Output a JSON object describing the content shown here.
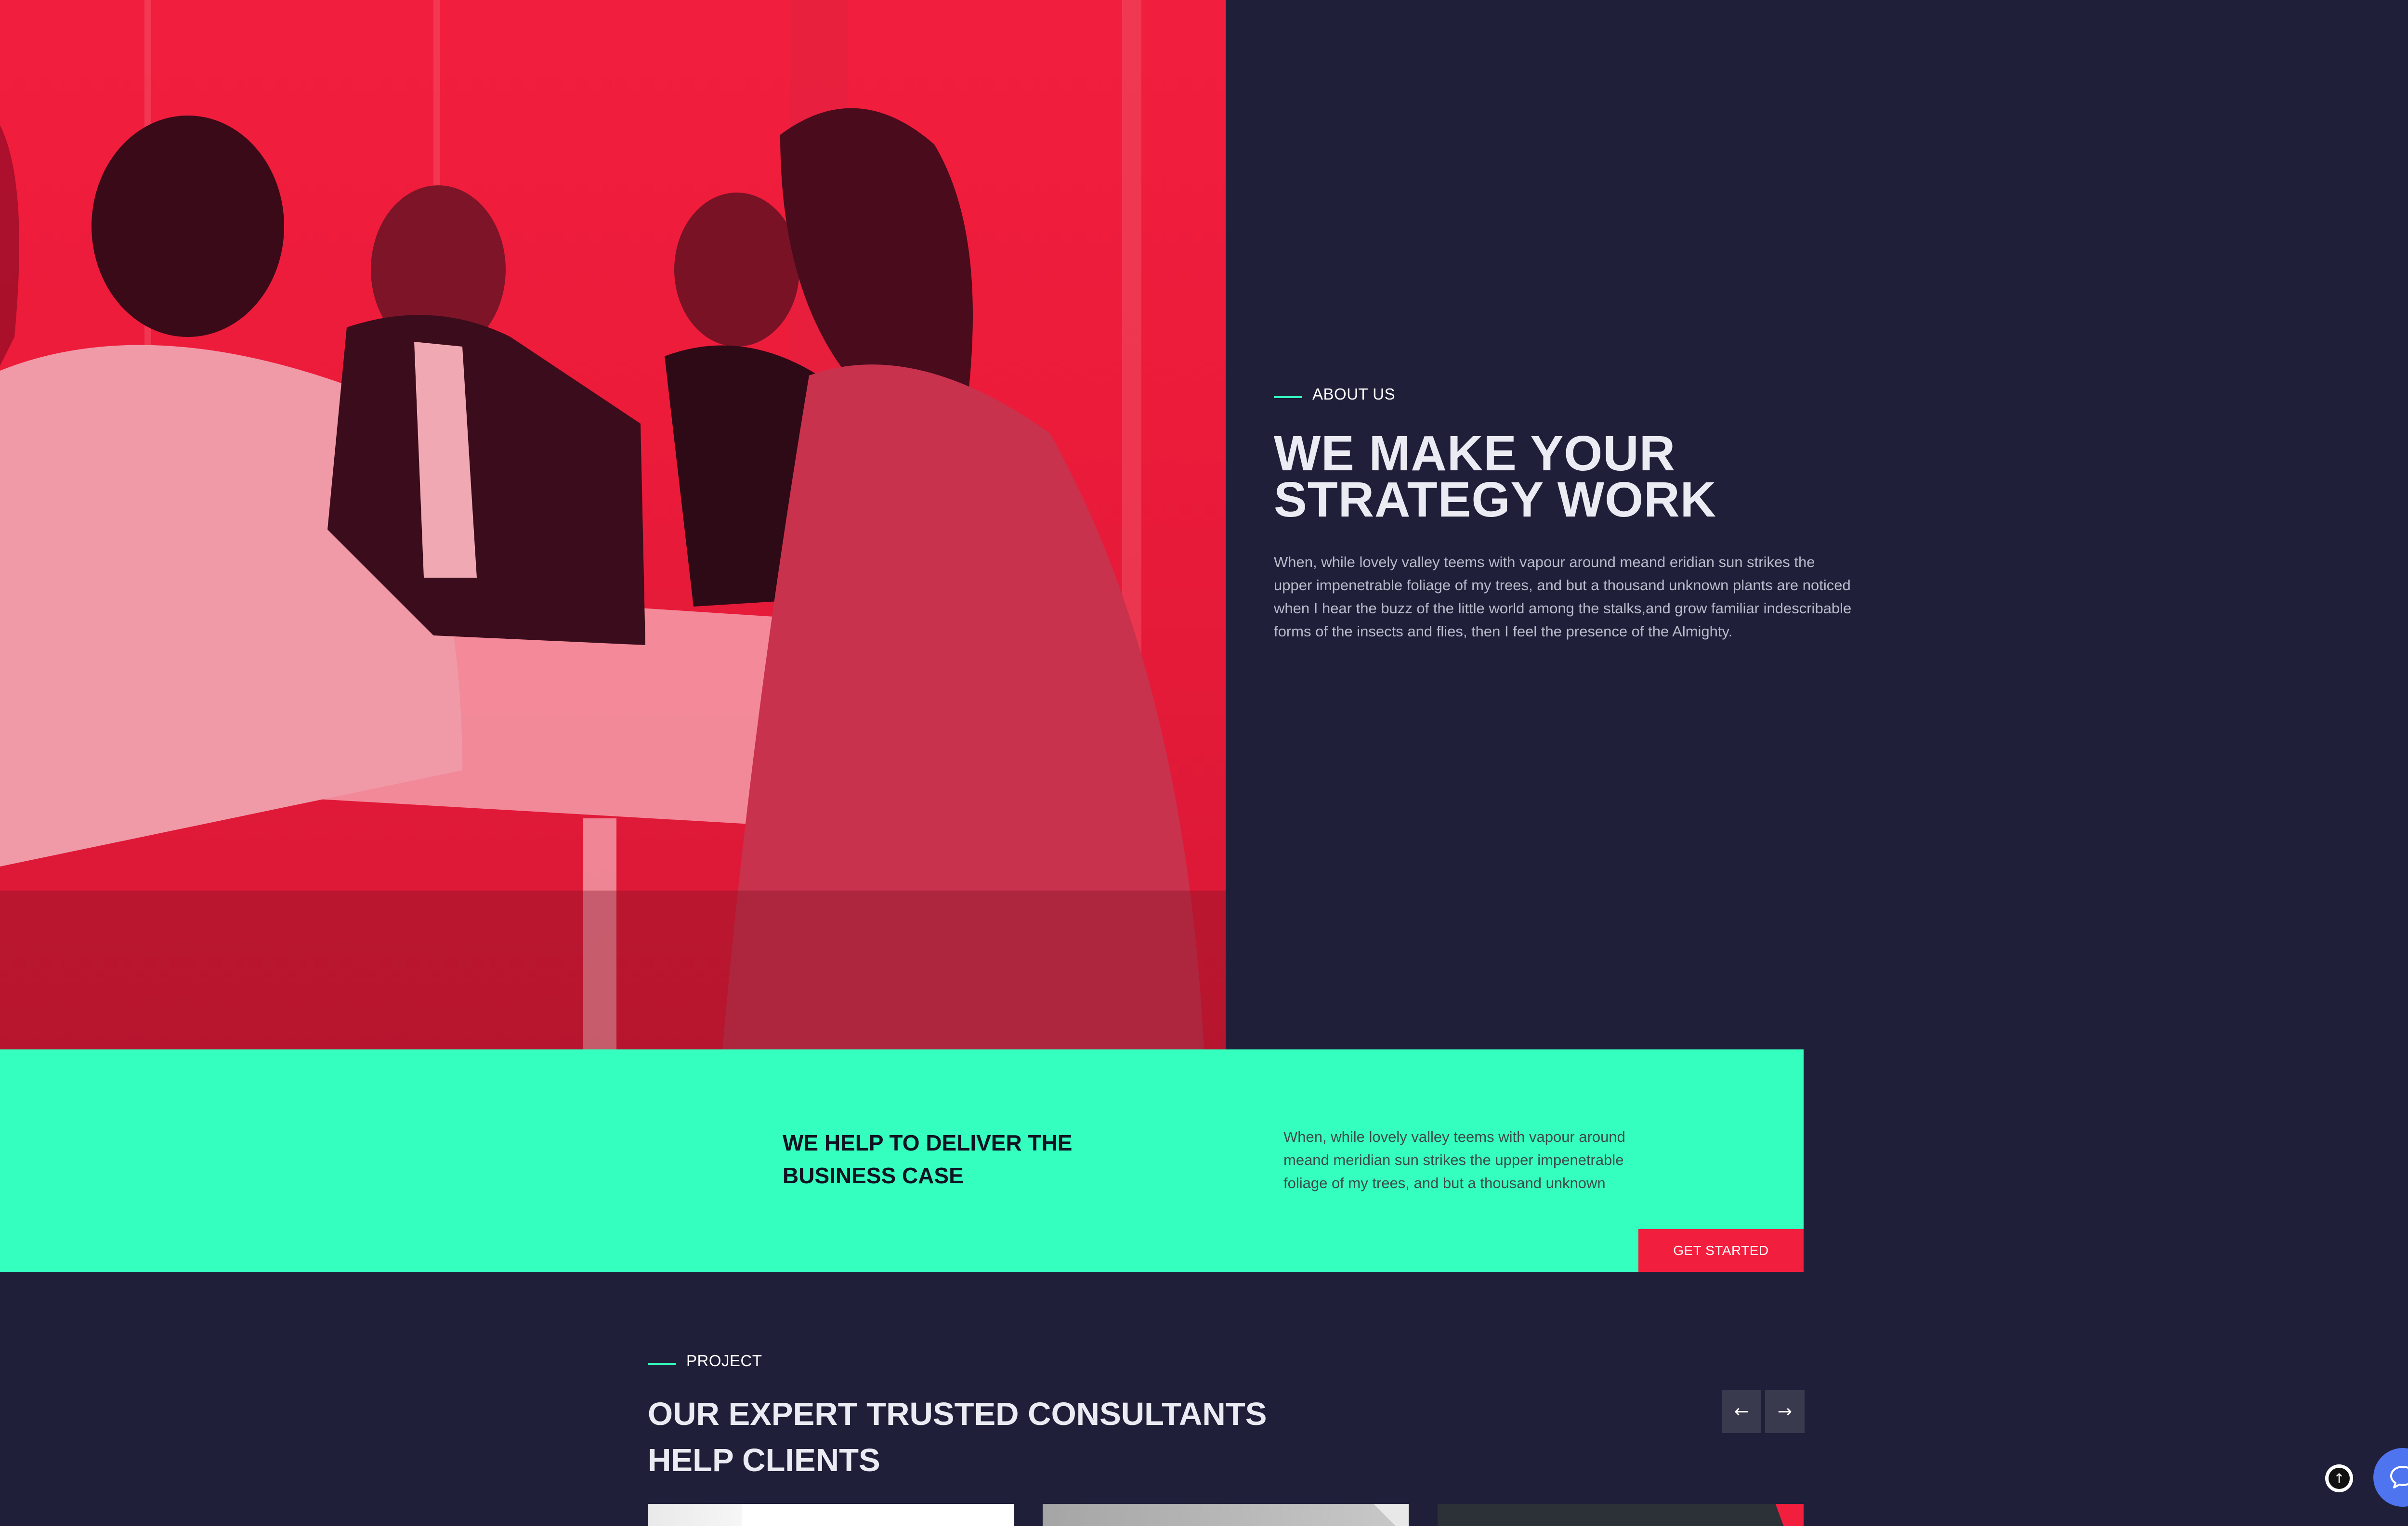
{
  "about": {
    "eyebrow": "ABOUT US",
    "title_line1": "WE MAKE YOUR",
    "title_line2": "STRATEGY WORK",
    "text": "When, while lovely valley teems with vapour around meand eridian sun strikes the upper impenetrable foliage of my trees, and but a thousand unknown plants are noticed when I hear the buzz of the little world among the stalks,and grow familiar indescribable forms of the insects and flies, then I feel the presence of the Almighty."
  },
  "cta": {
    "title_line1": "WE HELP TO DELIVER THE",
    "title_line2": "BUSINESS CASE",
    "text": "When, while lovely valley teems with vapour around meand meridian sun strikes the upper impenetrable foliage of my trees, and but a thousand unknown",
    "button_label": "GET STARTED"
  },
  "project": {
    "eyebrow": "PROJECT",
    "title_line1": "OUR EXPERT TRUSTED CONSULTANTS",
    "title_line2": "HELP CLIENTS",
    "prev_icon": "arrow-left-icon",
    "next_icon": "arrow-right-icon"
  },
  "floating": {
    "back_to_top_icon": "arrow-up-icon",
    "chat_icon": "chat-bubble-icon"
  },
  "colors": {
    "background": "#1f1f39",
    "accent_red": "#f21e3e",
    "accent_green": "#35ffbf",
    "chat_blue": "#4f74f0"
  }
}
